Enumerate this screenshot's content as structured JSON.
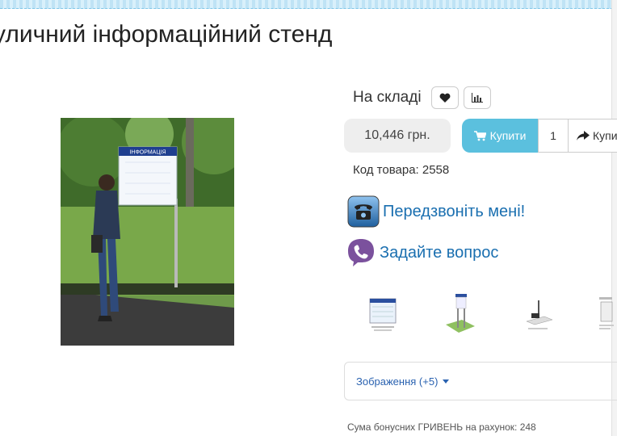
{
  "product": {
    "title": "уличний інформаційний стенд",
    "stock_status": "На складі",
    "price": "10,446 грн.",
    "buy_label": "Купити",
    "quantity": "1",
    "buy_secondary_label": "Купи",
    "code": "Код товара: 2558"
  },
  "contact": {
    "callback_label": "Передзвоніть мені!",
    "ask_label": "Задайте вопрос"
  },
  "gallery": {
    "photo_sign_text": "ІНФОРМАЦІЯ",
    "images_toggle": "Зображення (+5)"
  },
  "bonus": "Сума бонусних ГРИВЕНЬ на рахунок: 248",
  "icons": {
    "wishlist": "heart-icon",
    "compare": "bar-chart-icon",
    "cart": "cart-icon",
    "share": "share-icon",
    "phone": "phone-icon",
    "viber": "viber-icon"
  },
  "colors": {
    "buy_button": "#5bc0de",
    "link": "#1a6fb0",
    "price_bg": "#eeeeee"
  }
}
